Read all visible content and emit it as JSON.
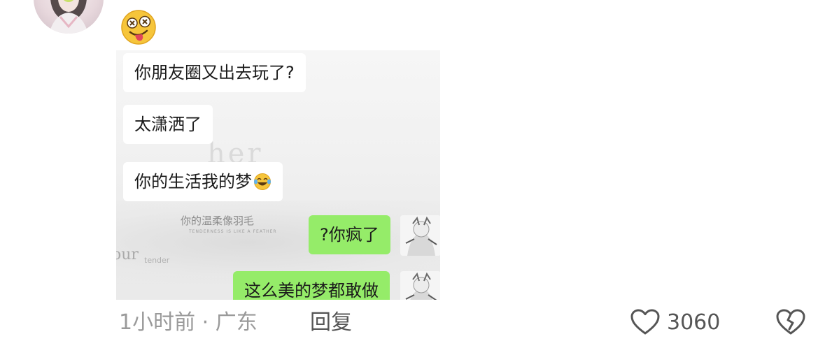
{
  "comment": {
    "chat_screenshot": {
      "messages": [
        {
          "side": "left",
          "text": "你朋友圈又出去玩了?"
        },
        {
          "side": "left",
          "text": "太潇洒了"
        },
        {
          "side": "left",
          "text": "你的生活我的梦",
          "emoji": "tears-of-joy-emoji"
        },
        {
          "side": "right",
          "text": "?你疯了"
        },
        {
          "side": "right",
          "text": "这么美的梦都敢做"
        }
      ],
      "background_text": {
        "her": "her",
        "feather": "你的温柔像羽毛",
        "tiny": "TENDERNESS IS LIKE A FEATHER",
        "our": "our",
        "tender": "tender"
      },
      "bubble_color": "#95ec69"
    },
    "timestamp": "1小时前",
    "location_separator": "·",
    "location": "广东",
    "reply_label": "回复",
    "like_count": "3060",
    "icons": {
      "avatar": "user-avatar",
      "reaction": "zany-face-emoji",
      "like": "heart-outline-icon",
      "dislike": "broken-heart-icon"
    }
  }
}
